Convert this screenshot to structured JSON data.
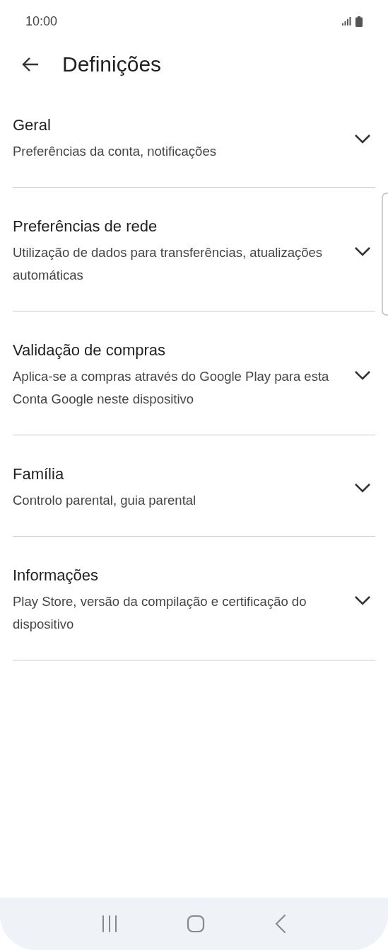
{
  "status_bar": {
    "time": "10:00"
  },
  "app_bar": {
    "title": "Definições"
  },
  "sections": [
    {
      "title": "Geral",
      "subtitle": "Preferências da conta, notificações",
      "expanded": false
    },
    {
      "title": "Preferências de rede",
      "subtitle": "Utilização de dados para transferências, atualizações automáticas",
      "expanded": false
    },
    {
      "title": "Validação de compras",
      "subtitle": "Aplica-se a compras através do Google Play para esta Conta Google neste dispositivo",
      "expanded": false
    },
    {
      "title": "Família",
      "subtitle": "Controlo parental, guia parental",
      "expanded": false
    },
    {
      "title": "Informações",
      "subtitle": "Play Store, versão da compilação e certificação do dispositivo",
      "expanded": false
    }
  ]
}
